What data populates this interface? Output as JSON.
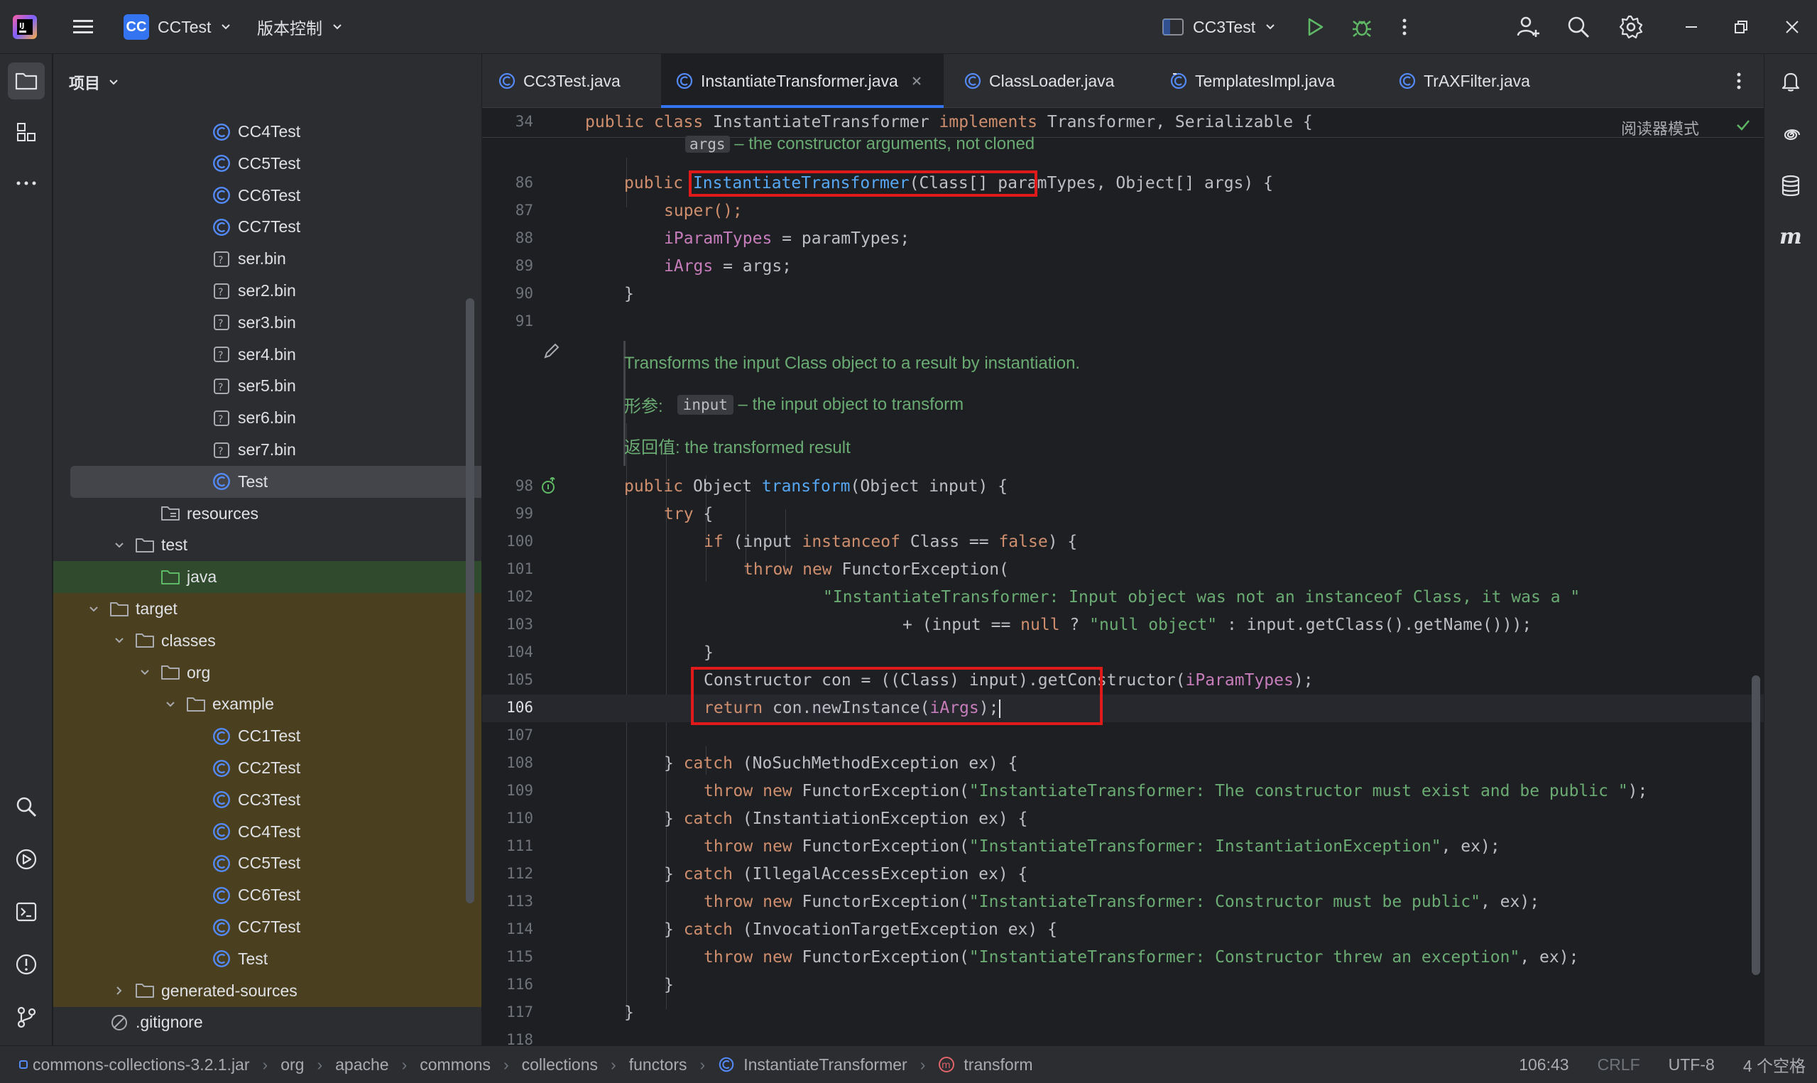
{
  "titlebar": {
    "project_badge": "CC",
    "project_name": "CCTest",
    "vcs_menu": "版本控制",
    "run_config": "CC3Test"
  },
  "project_panel": {
    "title": "项目",
    "items": [
      {
        "label": "CC4Test",
        "icon": "java-class-icon",
        "level": 6
      },
      {
        "label": "CC5Test",
        "icon": "java-class-icon",
        "level": 6
      },
      {
        "label": "CC6Test",
        "icon": "java-class-icon",
        "level": 6
      },
      {
        "label": "CC7Test",
        "icon": "java-class-icon",
        "level": 6
      },
      {
        "label": "ser.bin",
        "icon": "unknown-file-icon",
        "level": 6
      },
      {
        "label": "ser2.bin",
        "icon": "unknown-file-icon",
        "level": 6
      },
      {
        "label": "ser3.bin",
        "icon": "unknown-file-icon",
        "level": 6
      },
      {
        "label": "ser4.bin",
        "icon": "unknown-file-icon",
        "level": 6
      },
      {
        "label": "ser5.bin",
        "icon": "unknown-file-icon",
        "level": 6
      },
      {
        "label": "ser6.bin",
        "icon": "unknown-file-icon",
        "level": 6
      },
      {
        "label": "ser7.bin",
        "icon": "unknown-file-icon",
        "level": 6
      },
      {
        "label": "Test",
        "icon": "java-class-icon",
        "level": 6,
        "selected": true
      },
      {
        "label": "resources",
        "icon": "resources-folder-icon",
        "level": 4
      },
      {
        "label": "test",
        "icon": "folder-icon",
        "level": 3,
        "expanded": true
      },
      {
        "label": "java",
        "icon": "test-folder-icon",
        "level": 4
      },
      {
        "label": "target",
        "icon": "folder-icon",
        "level": 2,
        "expanded": true
      },
      {
        "label": "classes",
        "icon": "folder-icon",
        "level": 3,
        "expanded": true
      },
      {
        "label": "org",
        "icon": "folder-icon",
        "level": 4,
        "expanded": true
      },
      {
        "label": "example",
        "icon": "folder-icon",
        "level": 5,
        "expanded": true
      },
      {
        "label": "CC1Test",
        "icon": "java-class-icon",
        "level": 6
      },
      {
        "label": "CC2Test",
        "icon": "java-class-icon",
        "level": 6
      },
      {
        "label": "CC3Test",
        "icon": "java-class-icon",
        "level": 6
      },
      {
        "label": "CC4Test",
        "icon": "java-class-icon",
        "level": 6
      },
      {
        "label": "CC5Test",
        "icon": "java-class-icon",
        "level": 6
      },
      {
        "label": "CC6Test",
        "icon": "java-class-icon",
        "level": 6
      },
      {
        "label": "CC7Test",
        "icon": "java-class-icon",
        "level": 6
      },
      {
        "label": "Test",
        "icon": "java-class-icon",
        "level": 6
      },
      {
        "label": "generated-sources",
        "icon": "folder-icon",
        "level": 3,
        "expanded": false
      },
      {
        "label": ".gitignore",
        "icon": "ignored-file-icon",
        "level": 2
      }
    ]
  },
  "tabs": [
    {
      "label": "CC3Test.java",
      "active": false
    },
    {
      "label": "InstantiateTransformer.java",
      "active": true
    },
    {
      "label": "ClassLoader.java",
      "active": false
    },
    {
      "label": "TemplatesImpl.java",
      "active": false
    },
    {
      "label": "TrAXFilter.java",
      "active": false
    }
  ],
  "editor": {
    "reader_mode": "阅读器模式",
    "sticky_line_no": "34",
    "sticky_line": "public class InstantiateTransformer implements Transformer, Serializable {",
    "doc_param_name": "args",
    "doc_param_text": " – the constructor arguments, not cloned",
    "doc2_summary": "Transforms the input Class object to a result by instantiation.",
    "doc2_param_label": "形参:",
    "doc2_param_name": "input",
    "doc2_param_text": " – the input object to transform",
    "doc2_return": "返回值: the transformed result",
    "line_numbers": {
      "l86": "86",
      "l87": "87",
      "l88": "88",
      "l89": "89",
      "l90": "90",
      "l91": "91",
      "l98": "98",
      "l99": "99",
      "l100": "100",
      "l101": "101",
      "l102": "102",
      "l103": "103",
      "l104": "104",
      "l105": "105",
      "l106": "106",
      "l107": "107",
      "l108": "108",
      "l109": "109",
      "l110": "110",
      "l111": "111",
      "l112": "112",
      "l113": "113",
      "l114": "114",
      "l115": "115",
      "l116": "116",
      "l117": "117",
      "l118": "118"
    },
    "tokens": {
      "public": "public",
      "ctor_name": "InstantiateTransformer",
      "ctor_params": "(Class[] paramTypes, Object[] args)",
      "brace_open": " {",
      "super_call": "super();",
      "iParamTypes": "iParamTypes",
      "assign_paramTypes": " = paramTypes;",
      "iArgs": "iArgs",
      "assign_args": " = args;",
      "brace_close": "}",
      "object_type": " Object ",
      "transform": "transform",
      "transform_params": "(Object input) {",
      "try": "try",
      "if": "if",
      "if_open": " (input ",
      "instanceof": "instanceof",
      "class_eq": " Class == ",
      "false": "false",
      "if_close": ") {",
      "throw": "throw",
      "new": "new",
      "functor_open": " FunctorException(",
      "str_not_instance": "\"InstantiateTransformer: Input object was not an instanceof Class, it was a \"",
      "plus_input": "+ (input == ",
      "null": "null",
      "ternary_q": " ? ",
      "str_null_object": "\"null object\"",
      "ternary_rest": " : input.getClass().getName()));",
      "ctor_line_a": "Constructor con = ((Class) input).getConstructor(",
      "ctor_line_b": ");",
      "return": "return",
      "return_a": " con.newInstance(",
      "return_b": ");",
      "catch_close": "} ",
      "catch": "catch",
      "catch1": " (NoSuchMethodException ex) {",
      "functor_paren": " FunctorException(",
      "str_public": "\"InstantiateTransformer: The constructor must exist and be public \"",
      "end_paren": ");",
      "catch2": " (InstantiationException ex) {",
      "str_inst": "\"InstantiateTransformer: InstantiationException\"",
      "ex_end": ", ex);",
      "catch3": " (IllegalAccessException ex) {",
      "str_access": "\"InstantiateTransformer: Constructor must be public\"",
      "catch4": " (InvocationTargetException ex) {",
      "str_threw": "\"InstantiateTransformer: Constructor threw an exception\""
    }
  },
  "statusbar": {
    "breadcrumbs": [
      "commons-collections-3.2.1.jar",
      "org",
      "apache",
      "commons",
      "collections",
      "functors",
      "InstantiateTransformer",
      "transform"
    ],
    "position": "106:43",
    "line_ending": "CRLF",
    "encoding": "UTF-8",
    "indent": "4 个空格"
  },
  "colors": {
    "accent": "#3574f0",
    "keyword": "#cf8e6d",
    "string": "#6aab73",
    "field": "#c77dbb",
    "function": "#56a8f5",
    "highlight_box": "#e0191b"
  }
}
